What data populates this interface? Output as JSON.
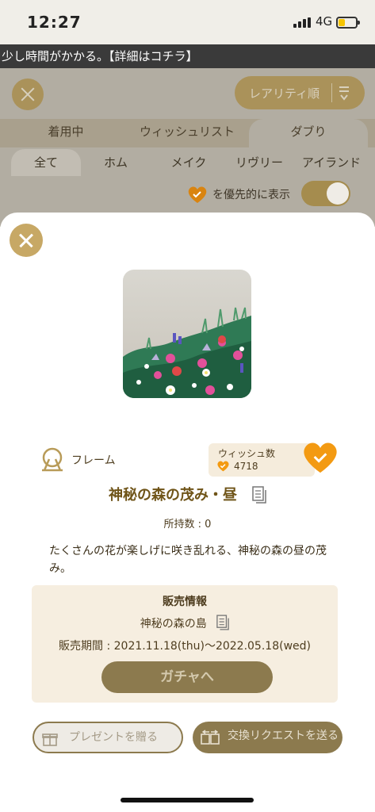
{
  "status_bar": {
    "time": "12:27",
    "network": "4G"
  },
  "ticker": {
    "text": "少し時間がかかる。【詳細はコチラ】"
  },
  "background": {
    "sort_label": "レアリティ順",
    "tabs": [
      {
        "label": "着用中"
      },
      {
        "label": "ウィッシュリスト"
      },
      {
        "label": "ダブり"
      }
    ],
    "categories": [
      {
        "label": "全て"
      },
      {
        "label": "ホム"
      },
      {
        "label": "メイク"
      },
      {
        "label": "リヴリー"
      },
      {
        "label": "アイランド"
      }
    ],
    "priority_label": "を優先的に表示"
  },
  "modal": {
    "item_type": "フレーム",
    "wish_label": "ウィッシュ数",
    "wish_count": "4718",
    "title": "神秘の森の茂み・昼",
    "owned": "所持数 : 0",
    "description": "たくさんの花が楽しげに咲き乱れる、神秘の森の昼の茂み。",
    "sale": {
      "heading": "販売情報",
      "island": "神秘の森の島",
      "period": "販売期間 : 2021.11.18(thu)〜2022.05.18(wed)",
      "gacha_button": "ガチャへ"
    },
    "present_button": "プレゼントを贈る",
    "trade_button": "交換リクエストを送る"
  },
  "colors": {
    "accent": "#c7a865",
    "brand_brown": "#8c7a4e",
    "heart": "#f39a12"
  }
}
